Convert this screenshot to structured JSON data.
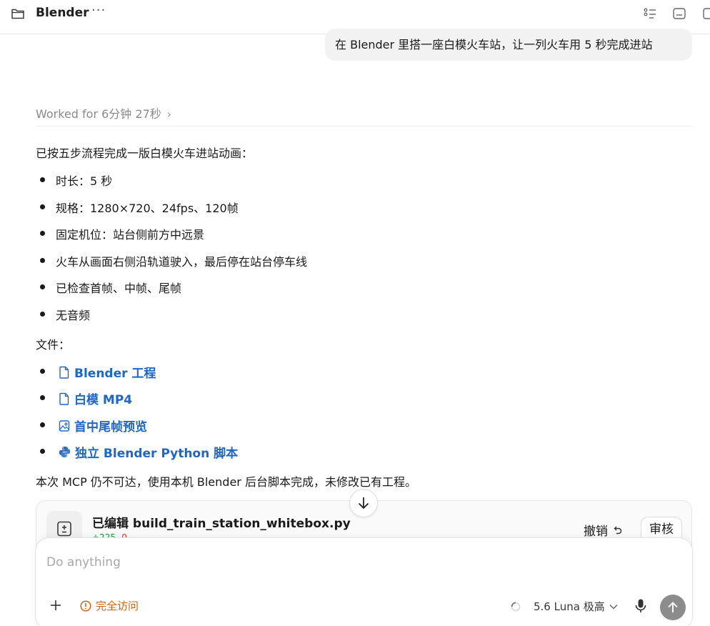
{
  "header": {
    "title": "Blender",
    "more": "···"
  },
  "user_message": "在 Blender 里搭一座白模火车站，让一列火车用 5 秒完成进站",
  "worked_for": "Worked for 6分钟 27秒",
  "response": {
    "intro": "已按五步流程完成一版白模火车进站动画：",
    "bullets": [
      "时长：5 秒",
      "规格：1280×720、24fps、120帧",
      "固定机位：站台侧前方中远景",
      "火车从画面右侧沿轨道驶入，最后停在站台停车线",
      "已检查首帧、中帧、尾帧",
      "无音频"
    ],
    "files_label": "文件：",
    "files": [
      {
        "label": "Blender 工程",
        "icon": "file-icon"
      },
      {
        "label": "白模 MP4",
        "icon": "file-icon"
      },
      {
        "label": "首中尾帧预览",
        "icon": "image-icon"
      },
      {
        "label": "独立 Blender Python 脚本",
        "icon": "python-icon"
      }
    ],
    "note": "本次 MCP 仍不可达，使用本机 Blender 后台脚本完成，未修改已有工程。"
  },
  "edit_card": {
    "title": "已编辑 build_train_station_whitebox.py",
    "added": "+225",
    "removed": "-0",
    "undo_label": "撤销",
    "review_label": "审核"
  },
  "composer": {
    "placeholder": "Do anything",
    "access_label": "完全访问",
    "model_label": "5.6 Luna 极高"
  },
  "colors": {
    "link": "#2066c6",
    "access": "#d0651a",
    "added": "#1d9a3a",
    "removed": "#dd3333",
    "send_button": "#8c8c8c"
  }
}
